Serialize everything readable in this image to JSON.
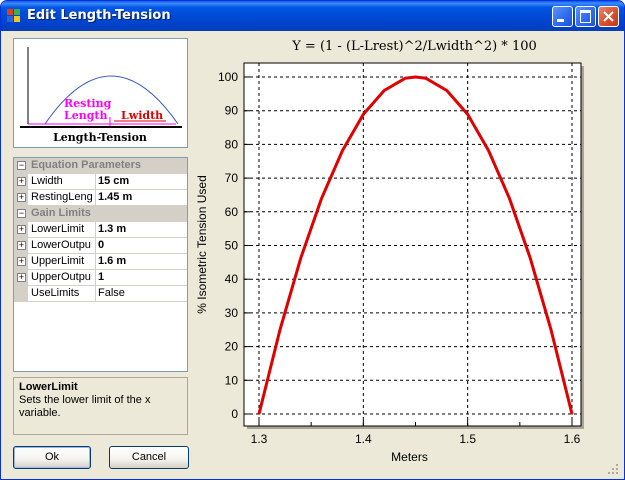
{
  "window": {
    "title": "Edit Length-Tension",
    "buttons": {
      "minimize": "minimize",
      "maximize": "maximize",
      "close": "close"
    }
  },
  "preview": {
    "label_resting": "Resting",
    "label_length": "Length",
    "label_lwidth": "Lwidth",
    "caption": "Length-Tension"
  },
  "propgrid": {
    "categories": [
      {
        "label": "Equation Parameters",
        "toggle": "−"
      },
      {
        "label": "Gain Limits",
        "toggle": "−"
      }
    ],
    "rows": [
      {
        "name": "Lwidth",
        "value": "15 cm",
        "toggle": "+"
      },
      {
        "name": "RestingLeng",
        "value": "1.45 m",
        "toggle": "+"
      },
      {
        "name": "LowerLimit",
        "value": "1.3 m",
        "toggle": "+"
      },
      {
        "name": "LowerOutpu",
        "value": "0",
        "toggle": "+"
      },
      {
        "name": "UpperLimit",
        "value": "1.6 m",
        "toggle": "+"
      },
      {
        "name": "UpperOutpu",
        "value": "1",
        "toggle": "+"
      },
      {
        "name": "UseLimits",
        "value": "False",
        "toggle": ""
      }
    ]
  },
  "description": {
    "title": "LowerLimit",
    "text": "Sets the lower limit of the x variable."
  },
  "buttons": {
    "ok": "Ok",
    "cancel": "Cancel"
  },
  "colors": {
    "curve": "#e00000",
    "preview_curve": "#3c5ac8",
    "preview_pink": "#ff00ff",
    "preview_red": "#e00000",
    "titlebar": "#0055e5"
  },
  "chart_data": {
    "type": "line",
    "title": "Y = (1 - (L-Lrest)^2/Lwidth^2) * 100",
    "xlabel": "Meters",
    "ylabel": "% Isometric Tension Used",
    "xlim": [
      1.3,
      1.6
    ],
    "ylim": [
      0,
      100
    ],
    "xticks": [
      "1.3",
      "1.4",
      "1.5",
      "1.6"
    ],
    "yticks": [
      "0",
      "10",
      "20",
      "30",
      "40",
      "50",
      "60",
      "70",
      "80",
      "90",
      "100"
    ],
    "grid": true,
    "series": [
      {
        "x": [
          1.3,
          1.32,
          1.34,
          1.36,
          1.38,
          1.4,
          1.42,
          1.44,
          1.45,
          1.46,
          1.48,
          1.5,
          1.52,
          1.54,
          1.56,
          1.58,
          1.6
        ],
        "values": [
          0,
          24.9,
          46.2,
          64,
          78.2,
          88.9,
          96,
          99.6,
          100,
          99.6,
          96,
          88.9,
          78.2,
          64,
          46.2,
          24.9,
          0
        ]
      }
    ]
  }
}
